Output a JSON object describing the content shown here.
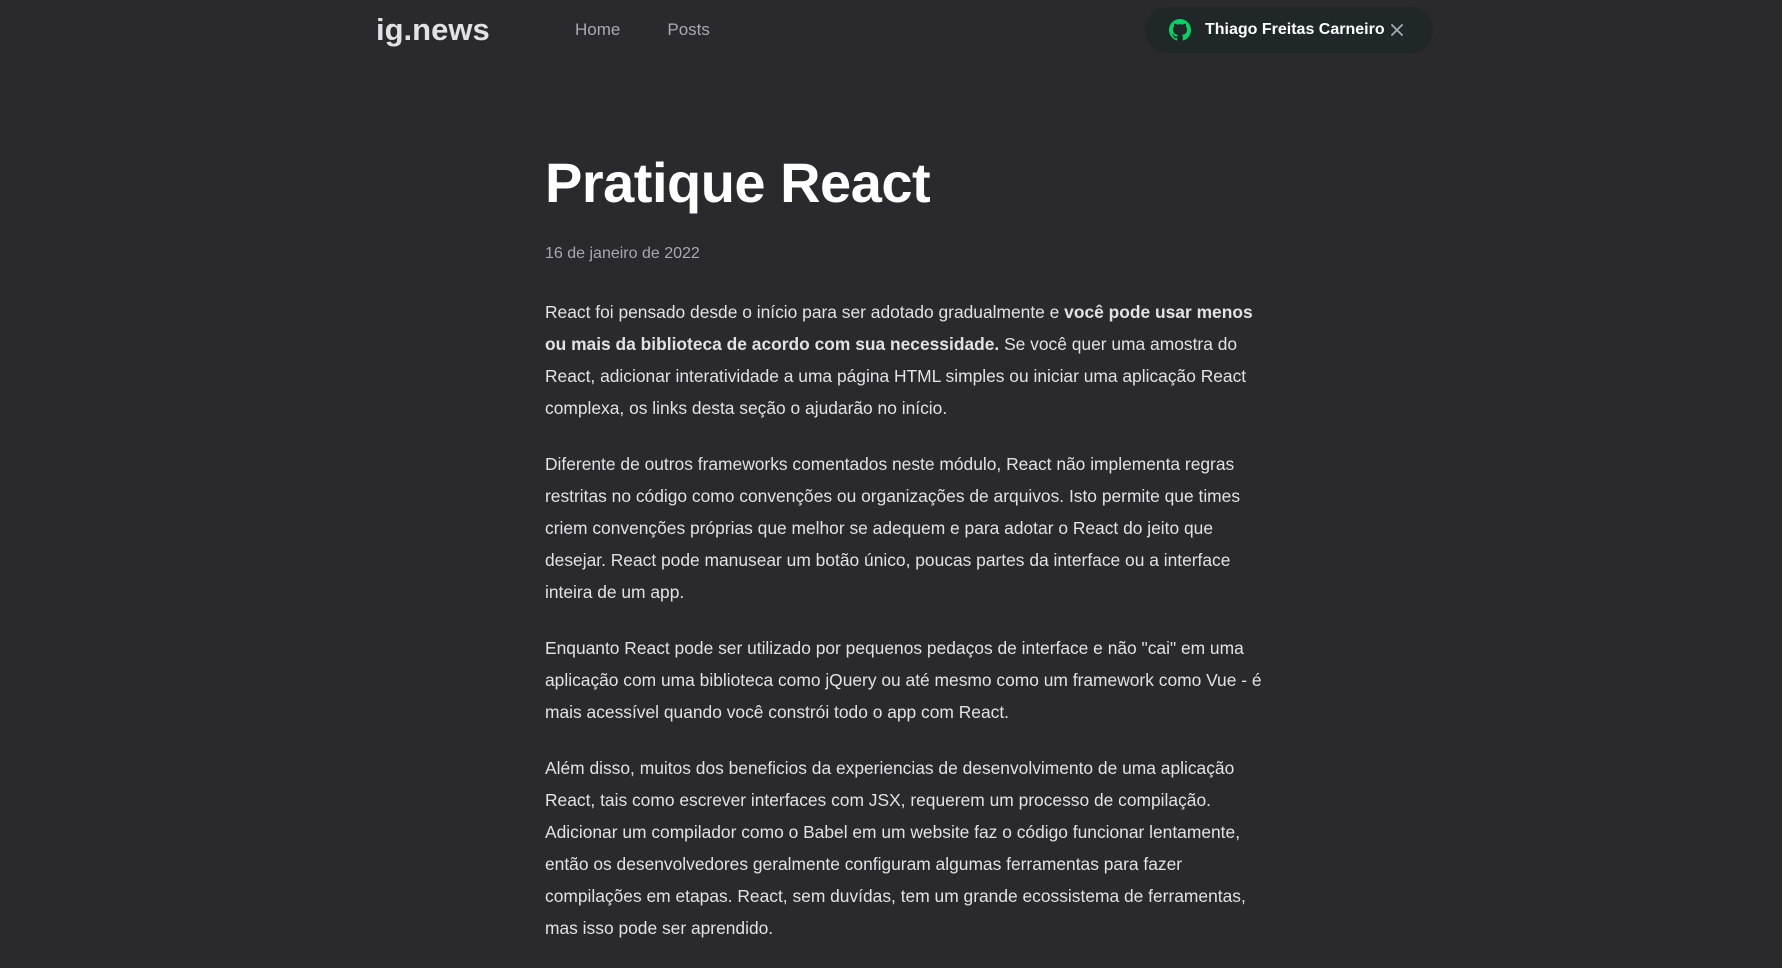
{
  "header": {
    "logo": "ig.news",
    "nav": [
      {
        "label": "Home"
      },
      {
        "label": "Posts"
      }
    ],
    "signin": {
      "user_name": "Thiago Freitas Carneiro",
      "icon": "github-icon",
      "close_icon": "close-icon",
      "icon_color": "#04d361"
    }
  },
  "post": {
    "title": "Pratique React",
    "date": "16 de janeiro de 2022",
    "paragraphs": [
      {
        "before": "React foi pensado desde o início para ser adotado gradualmente e ",
        "strong": "você pode usar menos ou mais da biblioteca de acordo com sua necessidade.",
        "after": " Se você quer uma amostra do React, adicionar interatividade a uma página HTML simples ou iniciar uma aplicação React complexa, os links desta seção o ajudarão no início."
      },
      {
        "text": "Diferente de outros frameworks comentados neste módulo, React não implementa regras restritas no código como convenções ou organizações de arquivos. Isto permite que times criem convenções próprias que melhor se adequem e para adotar o React do jeito que desejar. React pode manusear um botão único, poucas partes da interface ou a interface inteira de um app."
      },
      {
        "text": "Enquanto React pode ser utilizado por pequenos pedaços de interface e não \"cai\" em uma aplicação com uma biblioteca como jQuery ou até mesmo como um framework como Vue - é mais acessível quando você constrói todo o app com React."
      },
      {
        "text": "Além disso, muitos dos beneficios da experiencias de desenvolvimento de uma aplicação React, tais como escrever interfaces com JSX, requerem um processo de compilação. Adicionar um compilador como o Babel em um website faz o código funcionar lentamente, então os desenvolvedores geralmente configuram algumas ferramentas para fazer compilações em etapas. React, sem duvídas, tem um grande ecossistema de ferramentas, mas isso pode ser aprendido."
      }
    ]
  },
  "colors": {
    "background": "#29292e",
    "text": "#e1e1e6",
    "muted": "#a8a8b3",
    "accent": "#04d361"
  }
}
